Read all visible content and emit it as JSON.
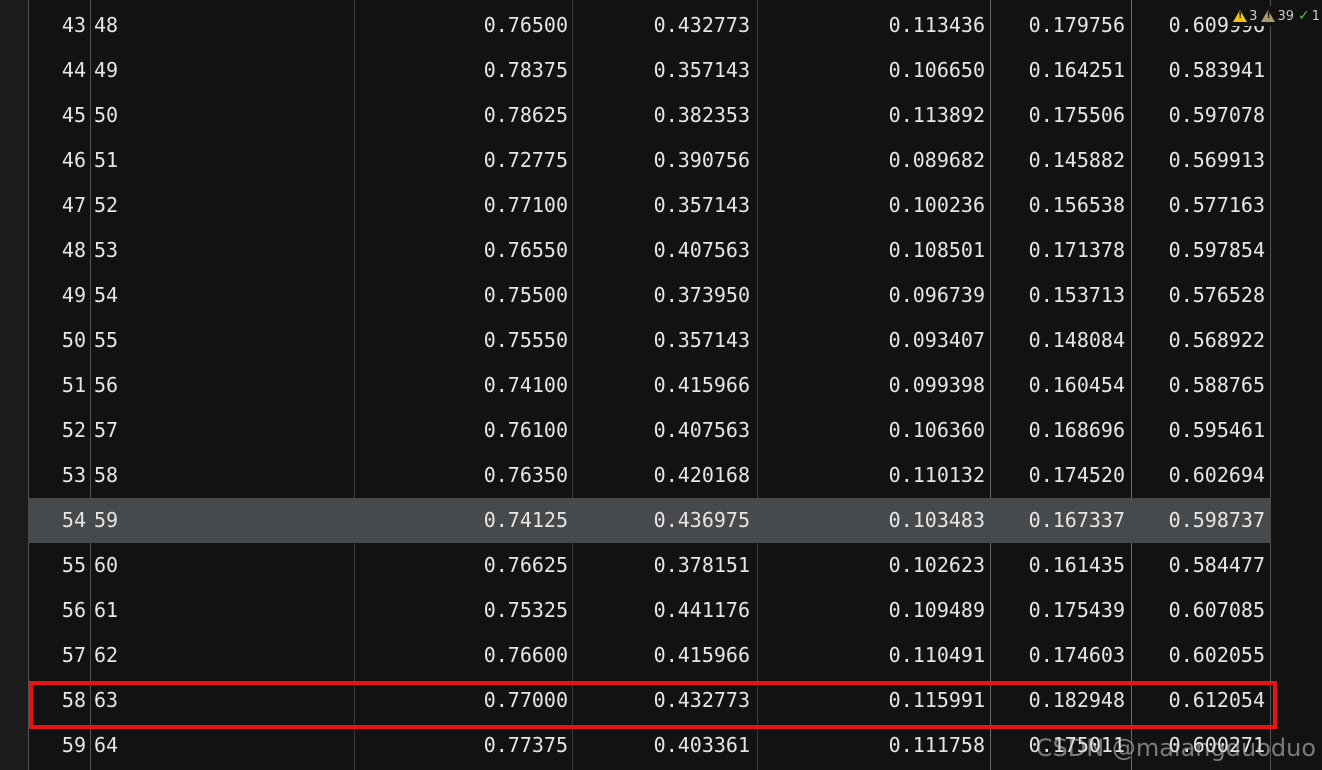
{
  "table": {
    "selected_index": 11,
    "highlighted_index": 15,
    "rows": [
      {
        "idx": "43",
        "epoch": "48",
        "v1": "0.76500",
        "v2": "0.432773",
        "v3": "0.113436",
        "v4": "0.179756",
        "v5": "0.609996"
      },
      {
        "idx": "44",
        "epoch": "49",
        "v1": "0.78375",
        "v2": "0.357143",
        "v3": "0.106650",
        "v4": "0.164251",
        "v5": "0.583941"
      },
      {
        "idx": "45",
        "epoch": "50",
        "v1": "0.78625",
        "v2": "0.382353",
        "v3": "0.113892",
        "v4": "0.175506",
        "v5": "0.597078"
      },
      {
        "idx": "46",
        "epoch": "51",
        "v1": "0.72775",
        "v2": "0.390756",
        "v3": "0.089682",
        "v4": "0.145882",
        "v5": "0.569913"
      },
      {
        "idx": "47",
        "epoch": "52",
        "v1": "0.77100",
        "v2": "0.357143",
        "v3": "0.100236",
        "v4": "0.156538",
        "v5": "0.577163"
      },
      {
        "idx": "48",
        "epoch": "53",
        "v1": "0.76550",
        "v2": "0.407563",
        "v3": "0.108501",
        "v4": "0.171378",
        "v5": "0.597854"
      },
      {
        "idx": "49",
        "epoch": "54",
        "v1": "0.75500",
        "v2": "0.373950",
        "v3": "0.096739",
        "v4": "0.153713",
        "v5": "0.576528"
      },
      {
        "idx": "50",
        "epoch": "55",
        "v1": "0.75550",
        "v2": "0.357143",
        "v3": "0.093407",
        "v4": "0.148084",
        "v5": "0.568922"
      },
      {
        "idx": "51",
        "epoch": "56",
        "v1": "0.74100",
        "v2": "0.415966",
        "v3": "0.099398",
        "v4": "0.160454",
        "v5": "0.588765"
      },
      {
        "idx": "52",
        "epoch": "57",
        "v1": "0.76100",
        "v2": "0.407563",
        "v3": "0.106360",
        "v4": "0.168696",
        "v5": "0.595461"
      },
      {
        "idx": "53",
        "epoch": "58",
        "v1": "0.76350",
        "v2": "0.420168",
        "v3": "0.110132",
        "v4": "0.174520",
        "v5": "0.602694"
      },
      {
        "idx": "54",
        "epoch": "59",
        "v1": "0.74125",
        "v2": "0.436975",
        "v3": "0.103483",
        "v4": "0.167337",
        "v5": "0.598737"
      },
      {
        "idx": "55",
        "epoch": "60",
        "v1": "0.76625",
        "v2": "0.378151",
        "v3": "0.102623",
        "v4": "0.161435",
        "v5": "0.584477"
      },
      {
        "idx": "56",
        "epoch": "61",
        "v1": "0.75325",
        "v2": "0.441176",
        "v3": "0.109489",
        "v4": "0.175439",
        "v5": "0.607085"
      },
      {
        "idx": "57",
        "epoch": "62",
        "v1": "0.76600",
        "v2": "0.415966",
        "v3": "0.110491",
        "v4": "0.174603",
        "v5": "0.602055"
      },
      {
        "idx": "58",
        "epoch": "63",
        "v1": "0.77000",
        "v2": "0.432773",
        "v3": "0.115991",
        "v4": "0.182948",
        "v5": "0.612054"
      },
      {
        "idx": "59",
        "epoch": "64",
        "v1": "0.77375",
        "v2": "0.403361",
        "v3": "0.111758",
        "v4": "0.175011",
        "v5": "0.600271"
      }
    ]
  },
  "inspections": {
    "warnings": "3",
    "weak_warnings": "39",
    "ok": "1",
    "warning_icon": "warning-triangle-icon",
    "weak_warning_icon": "weak-warning-triangle-icon",
    "ok_icon": "double-check-icon"
  },
  "watermark": "CSDN @maiangduoduo",
  "colors": {
    "background": "#121212",
    "text": "#e6e6e6",
    "selected_row": "#474a4d",
    "highlight_border": "#e81414",
    "warning": "#f2c21b",
    "ok": "#5dba4f"
  }
}
